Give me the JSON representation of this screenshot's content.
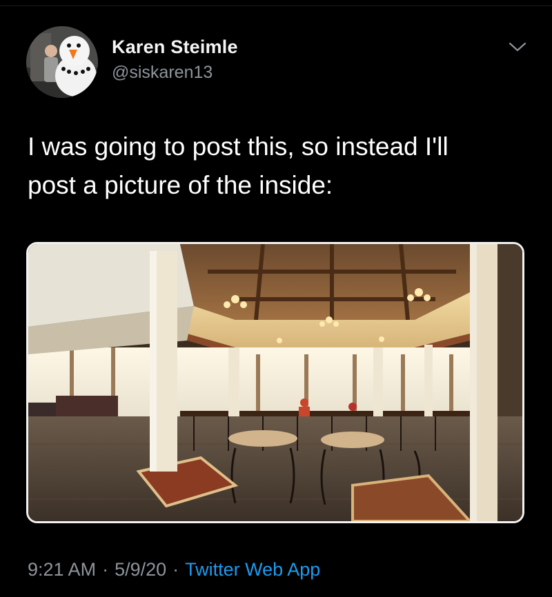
{
  "tweet": {
    "author": {
      "display_name": "Karen Steimle",
      "handle": "@siskaren13",
      "avatar": "snowman-costume-photo"
    },
    "text_lines": [
      "I was going to post this, so instead I'll",
      "post a picture of the inside:"
    ],
    "media": {
      "description": "photo",
      "icon": "restaurant-interior-photo"
    },
    "meta": {
      "time": "9:21 AM",
      "separator": "·",
      "date": "5/9/20",
      "source": "Twitter Web App"
    }
  },
  "icons": {
    "more": "chevron-down-icon"
  },
  "colors": {
    "background": "#000000",
    "text_primary": "#ffffff",
    "text_secondary": "#8e959b",
    "link": "#1d9bf0"
  }
}
